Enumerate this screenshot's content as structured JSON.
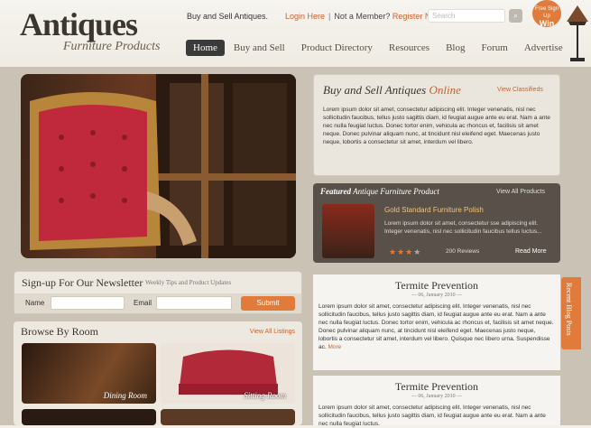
{
  "header": {
    "logo_title": "Antiques",
    "logo_subtitle": "Furniture Products",
    "tagline": "Buy and Sell Antiques.",
    "login_label": "Login Here",
    "member_question": "Not a Member?",
    "register_label": "Register Now",
    "search_placeholder": "Search",
    "badge_line1": "Free Sign Up",
    "badge_line2": "Win"
  },
  "nav": [
    {
      "label": "Home",
      "active": true
    },
    {
      "label": "Buy and Sell"
    },
    {
      "label": "Product Directory"
    },
    {
      "label": "Resources"
    },
    {
      "label": "Blog"
    },
    {
      "label": "Forum"
    },
    {
      "label": "Advertise"
    }
  ],
  "newsletter": {
    "title": "Sign-up For Our Newsletter",
    "subtitle": "Weekly Tips and Product Updates",
    "name_label": "Name",
    "email_label": "Email",
    "submit_label": "Submit"
  },
  "browse": {
    "title": "Browse By Room",
    "view_all": "View All Listings",
    "rooms": [
      "Dining Room",
      "Sitting Room"
    ]
  },
  "buy_sell": {
    "title_main": "Buy and Sell Antiques",
    "title_accent": "Online",
    "link": "View Classifieds",
    "text": "Lorem ipsum dolor sit amet, consectetur adipiscing elit. Integer venenatis, nisl nec sollicitudin faucibus, tellus justo sagittis diam, id feugiat augue ante eu erat. Nam a ante nec nulla feugiat luctus. Donec tortor enim, vehicula ac rhoncus et, facilisis sit amet neque. Donec pulvinar aliquam nunc, at tincidunt nisl eleifend eget. Maecenas justo neque, lobortis a consectetur sit amet, interdum vel libero."
  },
  "featured": {
    "title_main": "Featured",
    "title_rest": "Antique Furniture Product",
    "view_all": "View All Products",
    "product_name": "Gold Standard Furniture Polish",
    "description": "Lorem ipsum dolor sit amet, consectetur sse adipiscing elit. Integer venenatis, nisl nec sollicitudin faucibus tellus luctus...",
    "rating": 3,
    "rating_max": 4,
    "reviews": "200 Reviews",
    "read_more": "Read More"
  },
  "articles": [
    {
      "title": "Termite Prevention",
      "date": "— 06, January 2010 —",
      "text": "Lorem ipsum dolor sit amet, consectetur adipiscing elit. Integer venenatis, nisl nec sollicitudin faucibus, tellus justo sagittis diam, id feugiat augue ante eu erat. Nam a ante nec nulla feugiat luctus. Donec tortor enim, vehicula ac rhoncus et, facilisis sit amet neque. Donec pulvinar aliquam nunc, at tincidunt nisl eleifend eget. Maecenas justo neque, lobortis a consectetur sit amet, interdum vel libero. Quisque nec libero urna. Suspendisse ac.",
      "more": "More"
    },
    {
      "title": "Termite Prevention",
      "date": "— 06, January 2010 —",
      "text": "Lorem ipsum dolor sit amet, consectetur adipiscing elit. Integer venenatis, nisl nec sollicitudin faucibus, tellus justo sagittis diam, id feugiat augue ante eu erat. Nam a ante nec nulla feugiat luctus.",
      "more": ""
    }
  ],
  "recent_tab": "Recent Blog Posts",
  "colors": {
    "accent": "#e07b3c",
    "link": "#c9622d",
    "dark_panel": "#595149",
    "nav_active": "#3a3a3a"
  }
}
